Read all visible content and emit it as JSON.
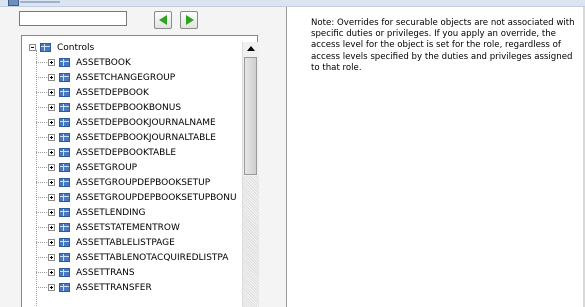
{
  "search": {
    "value": ""
  },
  "nav": {
    "prev_icon": "green-left-arrow-icon",
    "next_icon": "green-right-arrow-icon"
  },
  "tree": {
    "root": {
      "label": "Controls",
      "icon": "table-icon",
      "expanded": true
    },
    "items": [
      "ASSETBOOK",
      "ASSETCHANGEGROUP",
      "ASSETDEPBOOK",
      "ASSETDEPBOOKBONUS",
      "ASSETDEPBOOKJOURNALNAME",
      "ASSETDEPBOOKJOURNALTABLE",
      "ASSETDEPBOOKTABLE",
      "ASSETGROUP",
      "ASSETGROUPDEPBOOKSETUP",
      "ASSETGROUPDEPBOOKSETUPBONU",
      "ASSETLENDING",
      "ASSETSTATEMENTROW",
      "ASSETTABLELISTPAGE",
      "ASSETTABLENOTACQUIREDLISTPA",
      "ASSETTRANS",
      "ASSETTRANSFER"
    ]
  },
  "note": {
    "text": "Note: Overrides for securable objects are not associated with specific duties or privileges. If you apply an override, the access level for the object is set for the role, regardless of access levels specified by the duties and privileges assigned to that role."
  }
}
